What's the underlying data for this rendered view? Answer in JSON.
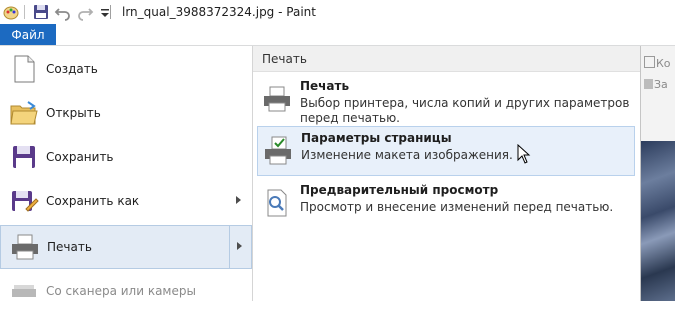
{
  "window": {
    "title": "lrn_qual_3988372324.jpg - Paint"
  },
  "ribbon": {
    "file_tab_label": "Файл",
    "right_buttons": [
      "Ко",
      "За"
    ]
  },
  "file_menu": {
    "items": [
      {
        "label": "Создать",
        "icon": "new-file-icon"
      },
      {
        "label": "Открыть",
        "icon": "open-folder-icon"
      },
      {
        "label": "Сохранить",
        "icon": "floppy-disk-icon"
      },
      {
        "label": "Сохранить как",
        "icon": "save-as-icon"
      },
      {
        "label": "Печать",
        "icon": "printer-icon"
      },
      {
        "label": "Со сканера или камеры",
        "icon": "scanner-icon"
      }
    ]
  },
  "print_panel": {
    "header": "Печать",
    "options": [
      {
        "title": "Печать",
        "description": "Выбор принтера, числа копий и других параметров перед печатью.",
        "icon": "printer-icon"
      },
      {
        "title": "Параметры страницы",
        "description": "Изменение макета изображения.",
        "icon": "page-setup-icon"
      },
      {
        "title": "Предварительный просмотр",
        "description": "Просмотр и внесение изменений перед печатью.",
        "icon": "print-preview-icon"
      }
    ]
  },
  "colors": {
    "file_tab": "#1c6ac1",
    "hover_highlight": "#e8f0fa",
    "active_item": "#e3ebf5"
  }
}
